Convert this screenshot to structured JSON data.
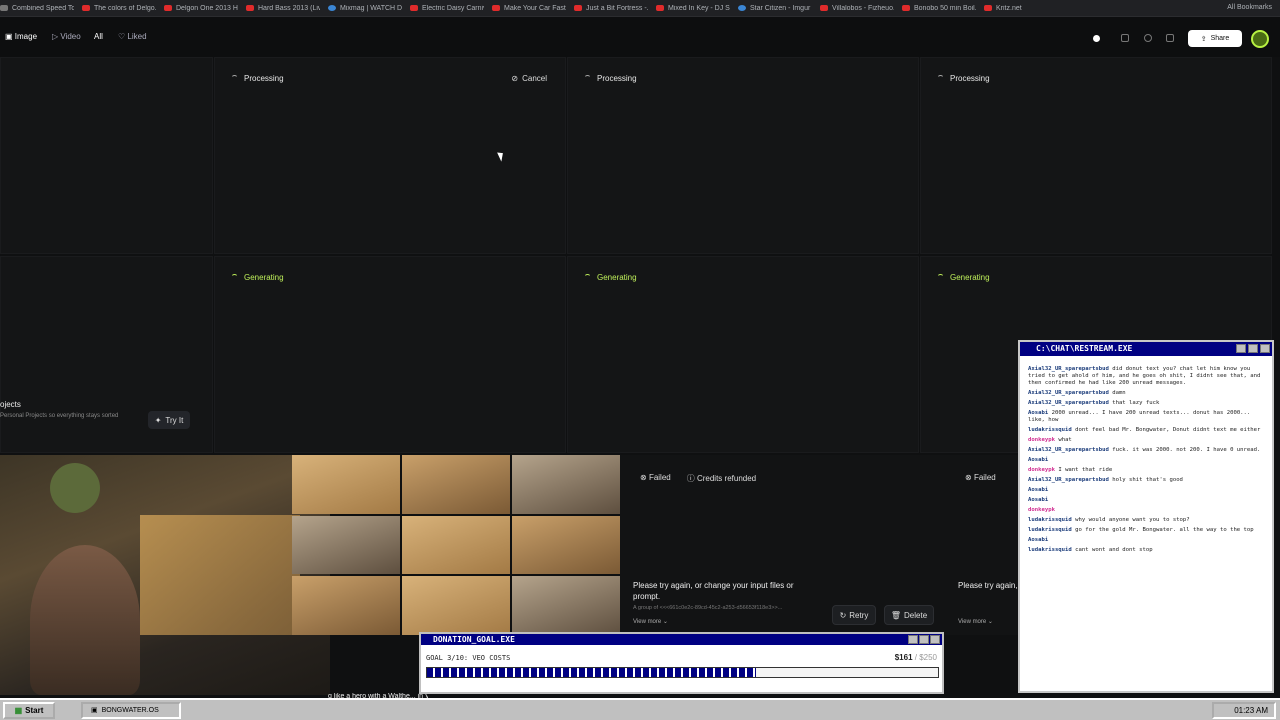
{
  "bookmarks": [
    "Combined Speed To...",
    "The colors of Delgo...",
    "Delgon One 2013 H...",
    "Hard Bass 2013 (Liv...",
    "Mixmag | WATCH D...",
    "Electric Daisy Carniv...",
    "Make Your Car Fast...",
    "Just a Bit Fortress -...",
    "Mixed In Key - DJ S...",
    "Star Citizen - Imgur",
    "Villalobos - Fizheuo...",
    "Bonobo 50 min Boil...",
    "Kritz.net"
  ],
  "all_bookmarks": "All Bookmarks",
  "toolbar": {
    "image": "Image",
    "video": "Video",
    "all": "All",
    "liked": "Liked",
    "share": "Share"
  },
  "cards": {
    "processing": "Processing",
    "generating": "Generating",
    "cancel": "Cancel"
  },
  "promo": {
    "title": "ojects",
    "subtitle": "Personal Projects so everything stays sorted",
    "try": "Try It"
  },
  "fail": {
    "failed": "Failed",
    "refunded": "Credits refunded",
    "message": "Please try again, or change your input files or prompt.",
    "id": "A group of <<<661c0e2c-89cd-45c2-a253-d56653f118e3>>...",
    "view_more": "View more",
    "retry": "Retry",
    "delete": "Delete",
    "message2": "Please try again, or prompt."
  },
  "webcam_caption": "g like a hero with a Walthe... in Vietnam. He has a c...",
  "chat": {
    "title": "C:\\CHAT\\RESTREAM.EXE",
    "messages": [
      {
        "user": "Axial32_UR_sparepartsbud",
        "text": "did donut text you? chat let him know you tried to get ahold of him, and he goes oh shit, I didnt see that, and then confirmed he had like 200 unread messages."
      },
      {
        "user": "Axial32_UR_sparepartsbud",
        "text": "damn"
      },
      {
        "user": "Axial32_UR_sparepartsbud",
        "text": "that lazy fuck"
      },
      {
        "user": "Aosabi",
        "text": "2000 unread... I have 200 unread texts... donut has 2000... like, how"
      },
      {
        "user": "ludakrissquid",
        "text": "dont feel bad Mr. Bongwater, Donut didnt text me either"
      },
      {
        "user": "donkeypk",
        "text": "what",
        "pink": true
      },
      {
        "user": "Axial32_UR_sparepartsbud",
        "text": "fuck. it was 2000. not 200. I have 0 unread."
      },
      {
        "user": "Aosabi",
        "text": ""
      },
      {
        "user": "donkeypk",
        "text": "I want that ride",
        "pink": true
      },
      {
        "user": "Axial32_UR_sparepartsbud",
        "text": "holy shit that's good"
      },
      {
        "user": "Aosabi",
        "text": ""
      },
      {
        "user": "Aosabi",
        "text": ""
      },
      {
        "user": "donkeypk",
        "text": "",
        "pink": true
      },
      {
        "user": "ludakrissquid",
        "text": "why would anyone want you to stop?"
      },
      {
        "user": "ludakrissquid",
        "text": "go for the gold Mr. Bongwater. all the way to the top"
      },
      {
        "user": "Aosabi",
        "text": ""
      },
      {
        "user": "ludakrissquid",
        "text": "cant wont and dont stop"
      }
    ]
  },
  "donation": {
    "title": "DONATION_GOAL.EXE",
    "goal": "GOAL 3/10: VEO COSTS",
    "amount": "$161",
    "max": " / $250",
    "progress": 0.644
  },
  "taskbar": {
    "start": "Start",
    "task": "BONGWATER.OS",
    "clock": "01:23 AM"
  },
  "colors": {
    "accent": "#bff05a",
    "win_title": "#000082"
  }
}
